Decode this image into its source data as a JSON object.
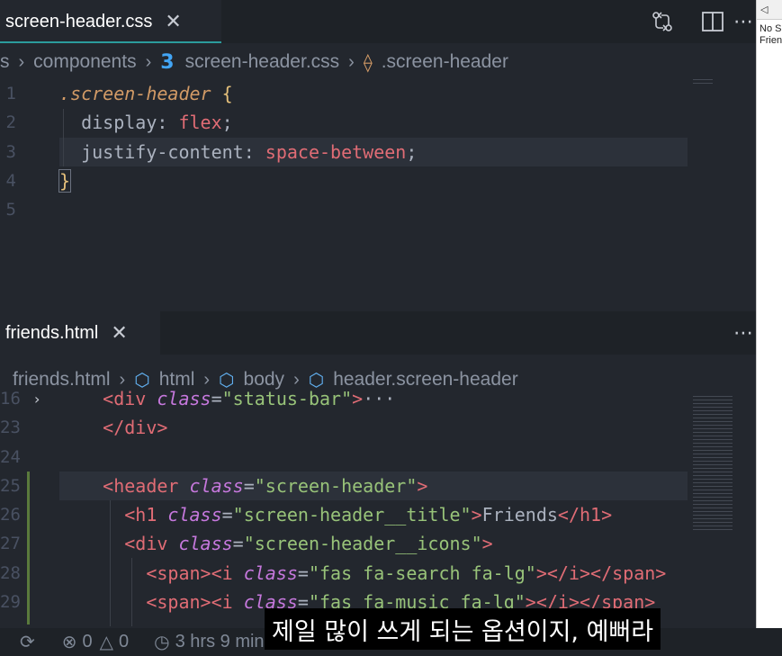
{
  "top_pane": {
    "tab_title": "screen-header.css",
    "breadcrumb": [
      "s",
      "components",
      "screen-header.css",
      ".screen-header"
    ],
    "lines": [
      {
        "n": "1",
        "tokens": [
          {
            "c": "sel",
            "t": ".screen-header"
          },
          {
            "c": "pun",
            "t": " "
          },
          {
            "c": "brc",
            "t": "{"
          }
        ]
      },
      {
        "n": "2",
        "tokens": [
          {
            "c": "prop",
            "t": "  display"
          },
          {
            "c": "pun",
            "t": ": "
          },
          {
            "c": "val",
            "t": "flex"
          },
          {
            "c": "pun",
            "t": ";"
          }
        ]
      },
      {
        "n": "3",
        "tokens": [
          {
            "c": "prop",
            "t": "  justify-content"
          },
          {
            "c": "pun",
            "t": ": "
          },
          {
            "c": "val",
            "t": "space-between"
          },
          {
            "c": "pun",
            "t": ";"
          }
        ]
      },
      {
        "n": "4",
        "tokens": [
          {
            "c": "brc-match",
            "t": "}"
          }
        ]
      },
      {
        "n": "5",
        "tokens": []
      }
    ]
  },
  "bottom_pane": {
    "tab_title": "friends.html",
    "breadcrumb": [
      "friends.html",
      "html",
      "body",
      "header.screen-header"
    ],
    "lines": [
      {
        "n": "16",
        "tokens": [
          {
            "c": "plain",
            "t": "    "
          },
          {
            "c": "tag",
            "t": "<div"
          },
          {
            "c": "attr",
            "t": " class"
          },
          {
            "c": "plain",
            "t": "="
          },
          {
            "c": "str",
            "t": "\"status-bar\""
          },
          {
            "c": "tag",
            "t": ">"
          },
          {
            "c": "plain",
            "t": "···"
          }
        ]
      },
      {
        "n": "23",
        "tokens": [
          {
            "c": "plain",
            "t": "    "
          },
          {
            "c": "tag",
            "t": "</div>"
          }
        ]
      },
      {
        "n": "24",
        "tokens": []
      },
      {
        "n": "25",
        "tokens": [
          {
            "c": "plain",
            "t": "    "
          },
          {
            "c": "tag",
            "t": "<header"
          },
          {
            "c": "attr",
            "t": " class"
          },
          {
            "c": "plain",
            "t": "="
          },
          {
            "c": "str",
            "t": "\"screen-header\""
          },
          {
            "c": "tag",
            "t": ">"
          }
        ]
      },
      {
        "n": "26",
        "tokens": [
          {
            "c": "plain",
            "t": "      "
          },
          {
            "c": "tag",
            "t": "<h1"
          },
          {
            "c": "attr",
            "t": " class"
          },
          {
            "c": "plain",
            "t": "="
          },
          {
            "c": "str",
            "t": "\"screen-header__title\""
          },
          {
            "c": "tag",
            "t": ">"
          },
          {
            "c": "plain",
            "t": "Friends"
          },
          {
            "c": "tag",
            "t": "</h1>"
          }
        ]
      },
      {
        "n": "27",
        "tokens": [
          {
            "c": "plain",
            "t": "      "
          },
          {
            "c": "tag",
            "t": "<div"
          },
          {
            "c": "attr",
            "t": " class"
          },
          {
            "c": "plain",
            "t": "="
          },
          {
            "c": "str",
            "t": "\"screen-header__icons\""
          },
          {
            "c": "tag",
            "t": ">"
          }
        ]
      },
      {
        "n": "28",
        "tokens": [
          {
            "c": "plain",
            "t": "        "
          },
          {
            "c": "tag",
            "t": "<span><i"
          },
          {
            "c": "attr",
            "t": " class"
          },
          {
            "c": "plain",
            "t": "="
          },
          {
            "c": "str",
            "t": "\"fas fa-search fa-lg\""
          },
          {
            "c": "tag",
            "t": "></i></span>"
          }
        ]
      },
      {
        "n": "29",
        "tokens": [
          {
            "c": "plain",
            "t": "        "
          },
          {
            "c": "tag",
            "t": "<span><i"
          },
          {
            "c": "attr",
            "t": " class"
          },
          {
            "c": "plain",
            "t": "="
          },
          {
            "c": "str",
            "t": "\"fas fa-music fa-lg\""
          },
          {
            "c": "tag",
            "t": "></i></span>"
          }
        ]
      }
    ]
  },
  "statusbar": {
    "errors": "0",
    "warnings": "0",
    "time": "3 hrs 9 mins"
  },
  "preview": {
    "line1": "No S",
    "line2": "Frienc"
  },
  "subtitle": "제일 많이 쓰게 되는 옵션이지, 예뻐라",
  "icons": {
    "top_actions": [
      "git-compare-icon",
      "split-editor-icon",
      "more-actions-icon"
    ],
    "bottom_actions": [
      "more-actions-icon"
    ],
    "status": [
      "sync-icon",
      "error-icon",
      "warning-icon",
      "history-icon"
    ]
  },
  "colors": {
    "background": "#23272e",
    "tab_accent": "#2b9c9c",
    "tag": "#e06c75",
    "attribute": "#c678dd",
    "string": "#98c379",
    "selector": "#d19a66"
  }
}
